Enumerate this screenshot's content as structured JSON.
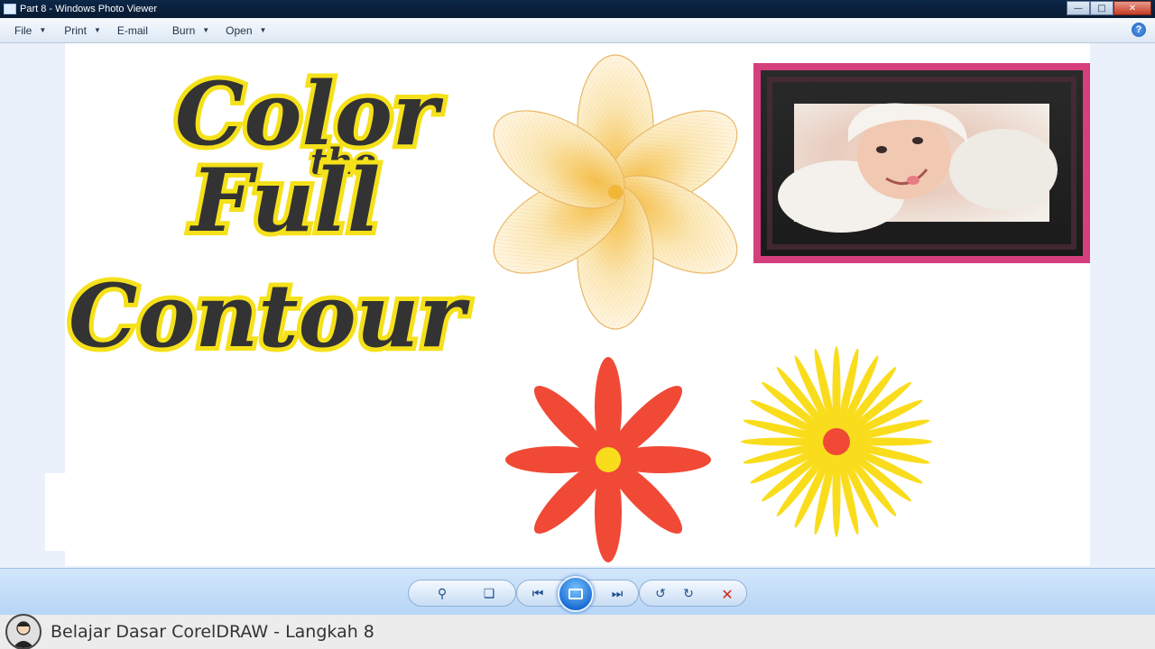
{
  "window": {
    "title": "Part 8 - Windows Photo Viewer"
  },
  "menu": [
    {
      "label": "File",
      "has_caret": true
    },
    {
      "label": "Print",
      "has_caret": true
    },
    {
      "label": "E-mail",
      "has_caret": false
    },
    {
      "label": "Burn",
      "has_caret": true
    },
    {
      "label": "Open",
      "has_caret": true
    }
  ],
  "artwork": {
    "line1": "Color",
    "line2": "the",
    "line3": "Full",
    "line4": "Contour",
    "colors": {
      "text": "#333333",
      "outline": "#f5e11a",
      "red_flower": "#f04a36",
      "yellow_flower": "#f9dd1c",
      "frame": "#d63f7e"
    }
  },
  "toolbar": {
    "zoom_icon": "zoom-magnifier-icon",
    "fit_icon": "actual-size-icon",
    "prev_icon": "previous-icon",
    "slideshow_icon": "slideshow-icon",
    "next_icon": "next-icon",
    "rotate_ccw_icon": "rotate-counterclockwise-icon",
    "rotate_cw_icon": "rotate-clockwise-icon",
    "delete_icon": "delete-icon"
  },
  "caption": {
    "text": "Belajar Dasar CorelDRAW - Langkah 8"
  }
}
